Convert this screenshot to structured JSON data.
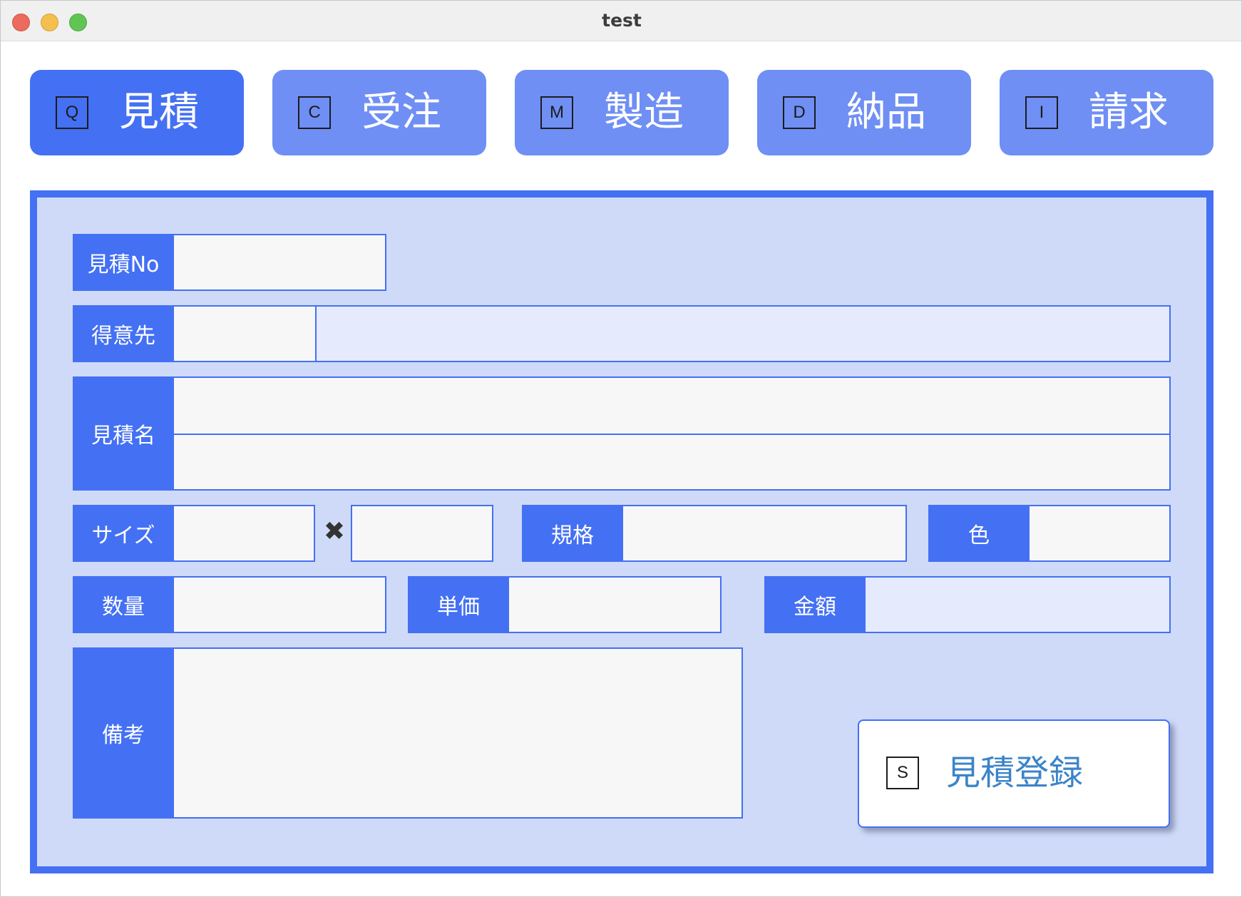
{
  "window": {
    "title": "test"
  },
  "nav": [
    {
      "key": "Q",
      "label": "見積",
      "active": true
    },
    {
      "key": "C",
      "label": "受注",
      "active": false
    },
    {
      "key": "M",
      "label": "製造",
      "active": false
    },
    {
      "key": "D",
      "label": "納品",
      "active": false
    },
    {
      "key": "I",
      "label": "請求",
      "active": false
    }
  ],
  "form": {
    "estimate_no": {
      "label": "見積No",
      "value": ""
    },
    "customer": {
      "label": "得意先",
      "code": "",
      "name": ""
    },
    "estimate_name": {
      "label": "見積名",
      "line1": "",
      "line2": ""
    },
    "size": {
      "label": "サイズ",
      "width": "",
      "separator": "✖",
      "height": ""
    },
    "spec": {
      "label": "規格",
      "value": ""
    },
    "color": {
      "label": "色",
      "value": ""
    },
    "quantity": {
      "label": "数量",
      "value": ""
    },
    "unit_price": {
      "label": "単価",
      "value": ""
    },
    "amount": {
      "label": "金額",
      "value": ""
    },
    "remarks": {
      "label": "備考",
      "value": ""
    }
  },
  "register_button": {
    "key": "S",
    "label": "見積登録"
  },
  "colors": {
    "accent": "#4470f3",
    "nav_inactive": "#6f8ff4",
    "panel_bg": "#cfdaf8",
    "readonly_field": "#e5ebfc",
    "register_text": "#3c84c8"
  }
}
